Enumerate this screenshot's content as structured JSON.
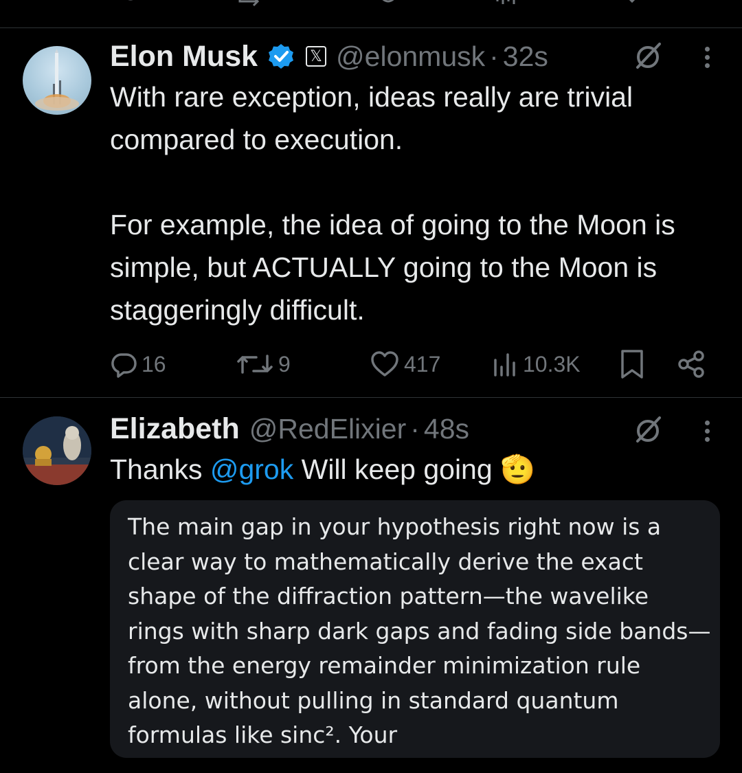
{
  "tweet1": {
    "name": "Elon Musk",
    "handle": "@elonmusk",
    "separator": "·",
    "time": "32s",
    "x_badge": "𝕏",
    "text": "With rare exception, ideas really are trivial compared to execution.\n\nFor example, the idea of going to the Moon is simple, but ACTUALLY going to the Moon is staggeringly difficult.",
    "stats": {
      "replies": "16",
      "reposts": "9",
      "likes": "417",
      "views": "10.3K"
    },
    "verified_color": "#1d9bf0"
  },
  "tweet2": {
    "name": "Elizabeth",
    "handle": "@RedElixier",
    "separator": "·",
    "time": "48s",
    "text_before": "Thanks ",
    "mention": "@grok",
    "text_after": " Will keep going ",
    "emoji": "🫡",
    "grok_response": "The main gap in your hypothesis right now is a clear way to mathematically derive the exact shape of the diffraction pattern—the wavelike rings with sharp dark gaps and fading side bands—from the energy remainder minimization rule alone, without pulling in standard quantum formulas like sinc². Your"
  },
  "icons": {
    "reply": "reply-icon",
    "repost": "repost-icon",
    "like": "heart-icon",
    "views": "views-icon",
    "bookmark": "bookmark-icon",
    "share": "share-icon",
    "grok": "grok-icon",
    "more": "more-icon"
  },
  "colors": {
    "background": "#000000",
    "text": "#e7e9ea",
    "secondary": "#71767b",
    "link": "#1d9bf0",
    "card": "#16181c"
  }
}
